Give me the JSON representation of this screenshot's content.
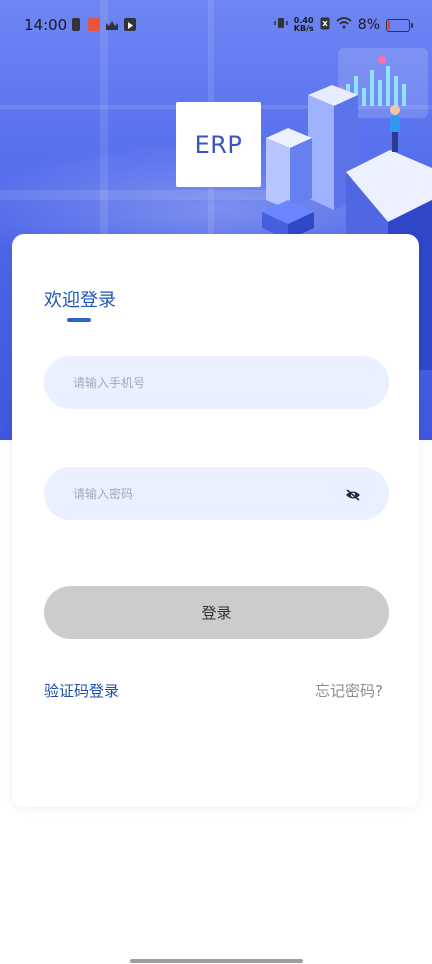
{
  "status_bar": {
    "time": "14:00",
    "net_speed_value": "0.40",
    "net_speed_unit": "KB/s",
    "battery_percent": "8%",
    "battery_level": 0.08,
    "battery_color": "#e53935"
  },
  "hero": {
    "logo_text": "ERP",
    "background_top": "#6f86f3",
    "background_bottom": "#3f56dd"
  },
  "login": {
    "title": "欢迎登录",
    "phone_placeholder": "请输入手机号",
    "password_placeholder": "请输入密码",
    "submit_label": "登录",
    "sms_login_label": "验证码登录",
    "forgot_password_label": "忘记密码?"
  },
  "colors": {
    "accent": "#1e55b9",
    "field_bg": "#eaf0ff",
    "button_disabled": "#cccccc"
  }
}
